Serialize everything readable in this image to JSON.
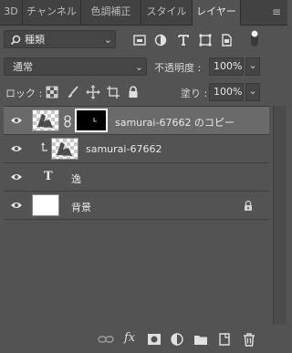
{
  "tabs": [
    {
      "label": "3D",
      "active": false
    },
    {
      "label": "チャンネル",
      "active": false
    },
    {
      "label": "色調補正",
      "active": false
    },
    {
      "label": "スタイル",
      "active": false
    },
    {
      "label": "レイヤー",
      "active": true
    }
  ],
  "filter": {
    "label": "種類"
  },
  "blend_mode": {
    "value": "通常"
  },
  "opacity": {
    "label": "不透明度 :",
    "value": "100%"
  },
  "lock": {
    "label": "ロック :"
  },
  "fill": {
    "label": "塗り :",
    "value": "100%"
  },
  "layers": [
    {
      "name": "samurai-67662 のコピー",
      "selected": true,
      "has_mask": true,
      "visible": true
    },
    {
      "name": "samurai-67662",
      "clipped": true,
      "visible": true
    },
    {
      "name": "逸",
      "type": "text",
      "visible": true
    },
    {
      "name": "背景",
      "locked": true,
      "visible": true
    }
  ],
  "text_layer_icon": "T",
  "fx_label": "fx",
  "colors": {
    "panel": "#535353",
    "tabbar": "#424242",
    "selected_row": "#6a6a6a"
  }
}
